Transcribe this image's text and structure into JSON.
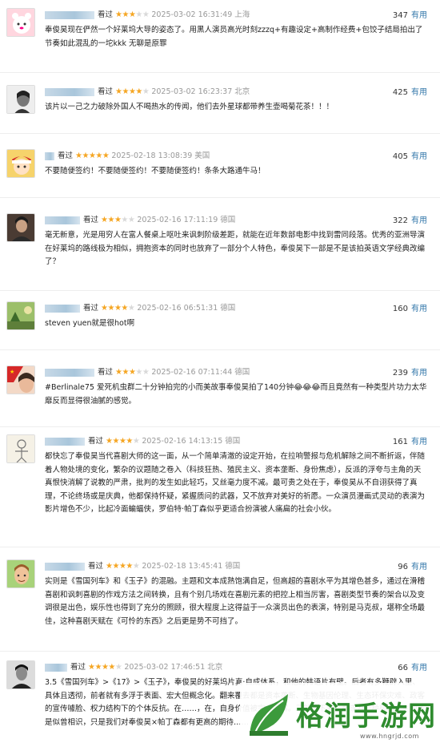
{
  "reviews": [
    {
      "watched": "看过",
      "stars": 3,
      "time": "2025-03-02 16:31:49",
      "location": "上海",
      "votes": "347",
      "useful": "有用",
      "text": "奉俊昊现在俨然一个好莱坞大导的姿态了。用黑人演员高光时刻zzzq+有趣设定+高制作经费+包饺子结局拍出了节奏如此混乱的一坨kkk 无聊是原罪",
      "avatar": "avatar-pink-cartoon"
    },
    {
      "watched": "看过",
      "stars": 4,
      "time": "2025-03-02 16:23:37",
      "location": "北京",
      "votes": "425",
      "useful": "有用",
      "text": "该片以一己之力破除外国人不喝热水的传闻，他们去外星球都带养生壶喝菊花茶！！！",
      "avatar": "avatar-bw-portrait"
    },
    {
      "watched": "看过",
      "stars": 5,
      "time": "2025-02-18 13:08:39",
      "location": "美国",
      "votes": "405",
      "useful": "有用",
      "text": "不要随便签约！不要随便签约！不要随便签约！条条大路通牛马！",
      "avatar": "avatar-anime-boy"
    },
    {
      "watched": "看过",
      "stars": 3,
      "time": "2025-02-16 17:11:19",
      "location": "德国",
      "votes": "322",
      "useful": "有用",
      "text": "毫无新意，光是用穷人在富人餐桌上呕吐来讽刺阶级差距，就能在近年数部电影中找到雷同段落。优秀的亚洲导演在好莱坞的路线极为相似，拥抱资本的同时也放弃了一部分个人特色，奉俊昊下一部是不是该拍英语文学经典改编了？",
      "avatar": "avatar-dark-photo"
    },
    {
      "watched": "看过",
      "stars": 4,
      "time": "2025-02-16 06:51:31",
      "location": "德国",
      "votes": "160",
      "useful": "有用",
      "text": "steven yuen就是很hot啊",
      "avatar": "avatar-green-nature"
    },
    {
      "watched": "看过",
      "stars": 3,
      "time": "2025-02-16 07:11:44",
      "location": "德国",
      "votes": "239",
      "useful": "有用",
      "text": "#Berlinale75 爱死机虫群二十分钟拍完的小而美故事奉俊昊拍了140分钟😂😂😂而且竟然有一种类型片功力太华靡反而显得很油腻的感觉。",
      "avatar": "avatar-red-flag"
    },
    {
      "watched": "看过",
      "stars": 4,
      "time": "2025-02-16 14:13:15",
      "location": "德国",
      "votes": "161",
      "useful": "有用",
      "text": "都快忘了奉俊昊当代喜剧大师的这一面，从一个简单清澈的设定开始，在拉响警报与危机解除之间不断折返，伴随着人物处境的变化，繁杂的议题随之卷入（科技狂热、殖民主义、资本垄断、身份焦虑），反派的浮夸与主角的天真恨快消解了说教的严肃，批判的发生如此轻巧，又丝毫力度不减。最可贵之处在于，奉俊昊从不自诩获得了真理，不论终场或是庆典，他都保持怀疑，紧握质问的武器，又不放弃对美好的祈愿。一众演员漫画式灵动的表演为影片增色不少，比起冷面蝙蝠侠，罗伯特·帕丁森似乎更适合扮演被人痛扁的社会小伙。",
      "avatar": "avatar-sketch-figure"
    },
    {
      "watched": "看过",
      "stars": 4,
      "time": "2025-02-18 13:45:41",
      "location": "德国",
      "votes": "96",
      "useful": "有用",
      "text": "实则是《雪国列车》和《玉子》的混融。主题和文本成熟饱满自足，但高超的喜剧水平为其增色甚多，通过在滑稽喜剧和讽刺喜剧的作戏方法之间转换，且有个别几场戏在喜剧元素的把控上相当厉害，喜剧类型节奏的架合以及变调很是出色，娱乐性也得到了充分的照顾，很大程度上这得益于一众演员出色的表演，特别是马克叔，堪称全场最佳，这种喜剧天赋在《可怜的东西》之后更是势不可挡了。",
      "avatar": "avatar-cartoon-man"
    },
    {
      "watched": "看过",
      "stars": 4,
      "time": "2025-03-02 17:46:51",
      "location": "北京",
      "votes": "66",
      "useful": "有用",
      "text": "3.5《雪国列车》>《17》>《玉子》，奉俊昊的好莱坞片真·自成体系，和他的韩语片有壁。后者有多鞭辟入里、具体且透彻，前者就有多浮于表面、宏大但概念化。翻来覆去都是资本垄断、生物基因伦理、生态环保灾难、政客的宣传噱脸、权力结构下的个体反抗。在……，在，自身价值被完全消解。三部拍下来，都成为一种极……主题还是似曾相识，只是我们对奉俊昊×帕丁森都有更高的期待……",
      "avatar": "avatar-bw-man"
    }
  ],
  "watermark": {
    "name": "格润手游网",
    "url": "www.hngrjd.com"
  }
}
